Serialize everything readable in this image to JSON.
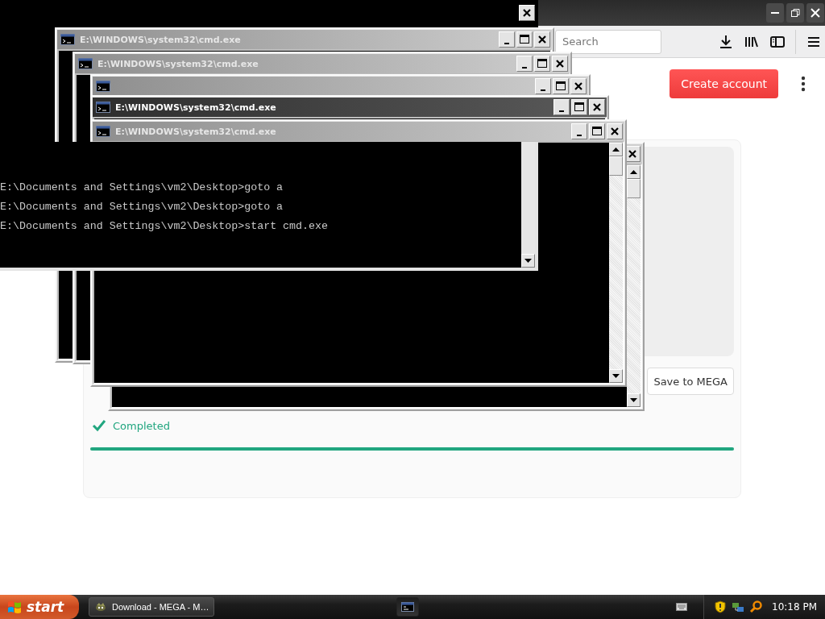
{
  "browser": {
    "search": {
      "placeholder": "Search"
    },
    "create_account": "Create account",
    "transfer": {
      "save_button": "Save to MEGA",
      "status": "Completed",
      "level": 1
    }
  },
  "console_windows": [
    {
      "active": false
    },
    {
      "title": "E:\\WINDOWS\\system32\\cmd.exe",
      "active": false
    },
    {
      "title": "E:\\WINDOWS\\system32\\cmd.exe",
      "active": false
    },
    {
      "active": false
    },
    {
      "title": "E:\\WINDOWS\\system32\\cmd.exe",
      "active": true
    },
    {
      "title": "E:\\WINDOWS\\system32\\cmd.exe",
      "active": false
    }
  ],
  "console_output": {
    "lines": [
      "E:\\Documents and Settings\\vm2\\Desktop>goto a",
      "E:\\Documents and Settings\\vm2\\Desktop>goto a",
      "E:\\Documents and Settings\\vm2\\Desktop>start cmd.exe"
    ]
  },
  "taskbar": {
    "start": "start",
    "tasks": [
      {
        "label": "Download - MEGA - M…",
        "kind": "browser",
        "selected": false
      },
      {
        "kind": "console",
        "selected": true
      }
    ],
    "clock": "10:18 PM"
  }
}
